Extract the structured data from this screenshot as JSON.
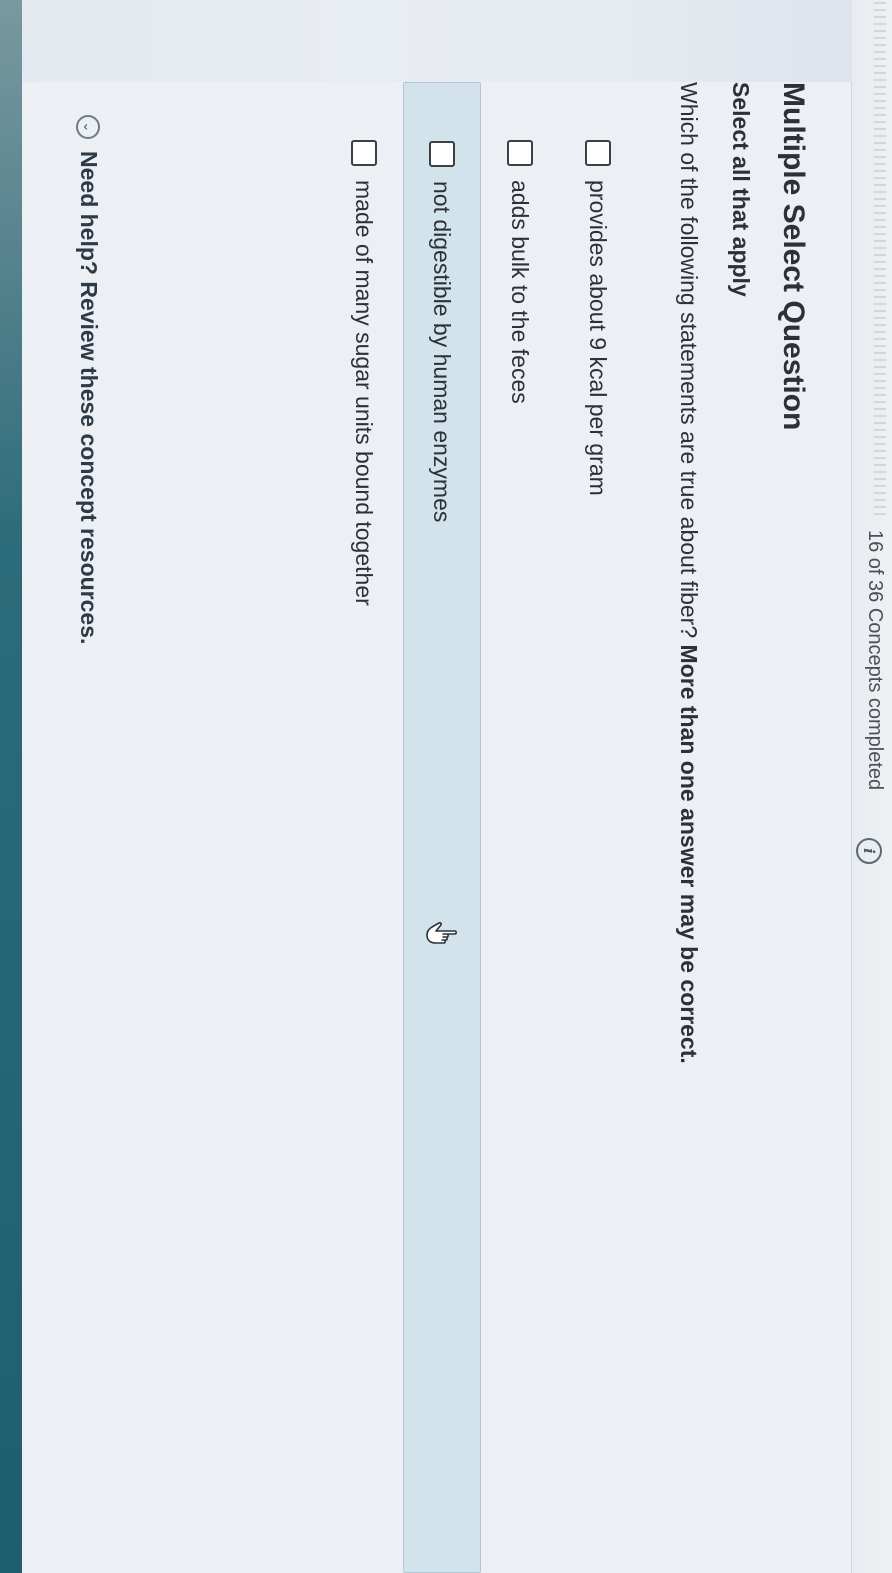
{
  "header": {
    "progress_text": "16 of 36 Concepts completed",
    "info_icon": "info-icon",
    "info_glyph": "i"
  },
  "question": {
    "type_title": "Multiple Select Question",
    "instruction": "Select all that apply",
    "prompt_plain": "Which of the following statements are true about fiber? ",
    "prompt_bold": "More than one answer may be correct."
  },
  "options": [
    {
      "label": "provides about 9 kcal per gram",
      "checked": false
    },
    {
      "label": "adds bulk to the feces",
      "checked": false
    },
    {
      "label": "not digestible by human enzymes",
      "checked": false,
      "hovered": true
    },
    {
      "label": "made of many sugar units bound together",
      "checked": false
    }
  ],
  "help": {
    "icon": "chevron-down-icon",
    "text": "Need help? Review these concept resources."
  },
  "colors": {
    "hover_bg": "#d2e3ec",
    "accent_strip": "#1f5f6d"
  }
}
